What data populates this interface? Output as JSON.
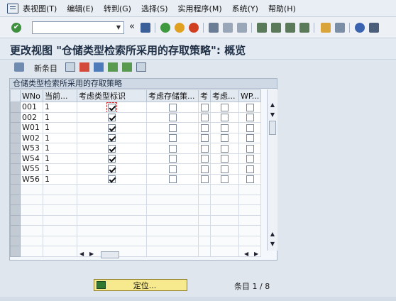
{
  "menu": {
    "items": [
      "表视图(T)",
      "编辑(E)",
      "转到(G)",
      "选择(S)",
      "实用程序(M)",
      "系统(Y)",
      "帮助(H)"
    ]
  },
  "toolbar": {
    "command_value": "",
    "collapse_label": "«",
    "icons": [
      "enter-icon",
      "save-icon",
      "back-icon",
      "exit-icon",
      "cancel-icon",
      "print-icon",
      "find-icon",
      "find-next-icon",
      "first-page-icon",
      "prev-page-icon",
      "next-page-icon",
      "last-page-icon",
      "new-session-icon",
      "shortcut-icon",
      "help-icon",
      "layout-icon"
    ]
  },
  "title": "更改视图 \"仓储类型检索所采用的存取策略\": 概览",
  "app_toolbar": {
    "new_entries": "新条目"
  },
  "table": {
    "panel_title": "仓储类型检索所采用的存取策略",
    "columns": [
      "WNo",
      "当前...",
      "考虑类型标识",
      "考虑存储策...",
      "考",
      "考虑...",
      "WP..."
    ],
    "rows": [
      {
        "wno": "001",
        "cur": "1",
        "c1": true,
        "c2": false,
        "c3": false,
        "c4": false,
        "c5": false
      },
      {
        "wno": "002",
        "cur": "1",
        "c1": true,
        "c2": false,
        "c3": false,
        "c4": false,
        "c5": false
      },
      {
        "wno": "W01",
        "cur": "1",
        "c1": true,
        "c2": false,
        "c3": false,
        "c4": false,
        "c5": false
      },
      {
        "wno": "W02",
        "cur": "1",
        "c1": true,
        "c2": false,
        "c3": false,
        "c4": false,
        "c5": false
      },
      {
        "wno": "W53",
        "cur": "1",
        "c1": true,
        "c2": false,
        "c3": false,
        "c4": false,
        "c5": false
      },
      {
        "wno": "W54",
        "cur": "1",
        "c1": true,
        "c2": false,
        "c3": false,
        "c4": false,
        "c5": false
      },
      {
        "wno": "W55",
        "cur": "1",
        "c1": true,
        "c2": false,
        "c3": false,
        "c4": false,
        "c5": false
      },
      {
        "wno": "W56",
        "cur": "1",
        "c1": true,
        "c2": false,
        "c3": false,
        "c4": false,
        "c5": false
      }
    ],
    "empty_rows": 7
  },
  "footer": {
    "locate_label": "定位...",
    "entry_count": "条目 1 / 8"
  },
  "colors": {
    "accent": "#3e8f3e",
    "button_yellow": "#f7e98d",
    "header_bg": "#e3e9f0"
  }
}
